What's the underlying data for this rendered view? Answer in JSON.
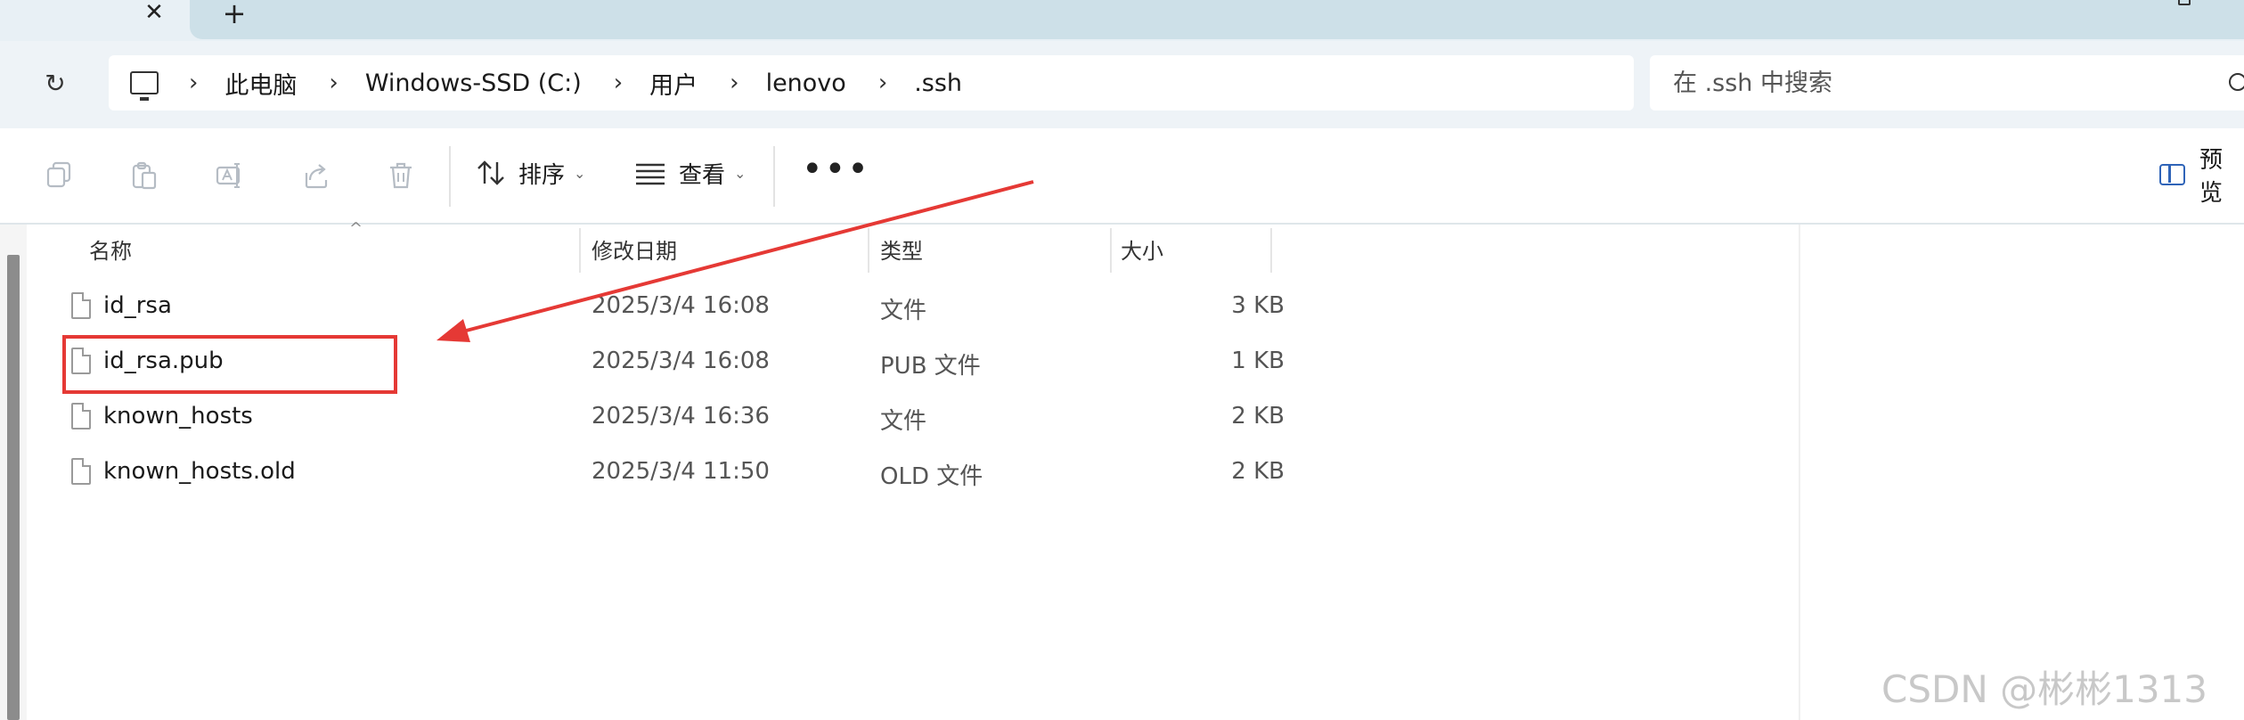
{
  "tab": {
    "close_glyph": "✕",
    "new_glyph": "+"
  },
  "address": {
    "refresh_glyph": "↻",
    "crumbs": [
      "此电脑",
      "Windows-SSD (C:)",
      "用户",
      "lenovo",
      ".ssh"
    ],
    "separator": "›"
  },
  "search": {
    "placeholder": "在 .ssh 中搜索"
  },
  "toolbar": {
    "sort_label": "排序",
    "view_label": "查看",
    "more_label": "•••",
    "preview_label": "预览",
    "icons": [
      "copy-icon",
      "paste-icon",
      "rename-icon",
      "share-icon",
      "delete-icon"
    ]
  },
  "columns": {
    "name": "名称",
    "date": "修改日期",
    "type": "类型",
    "size": "大小"
  },
  "files": [
    {
      "name": "id_rsa",
      "date": "2025/3/4 16:08",
      "type": "文件",
      "size": "3 KB"
    },
    {
      "name": "id_rsa.pub",
      "date": "2025/3/4 16:08",
      "type": "PUB 文件",
      "size": "1 KB"
    },
    {
      "name": "known_hosts",
      "date": "2025/3/4 16:36",
      "type": "文件",
      "size": "2 KB"
    },
    {
      "name": "known_hosts.old",
      "date": "2025/3/4 11:50",
      "type": "OLD 文件",
      "size": "2 KB"
    }
  ],
  "annotation": {
    "color": "#e53935"
  },
  "watermark": "CSDN @彬彬1313"
}
